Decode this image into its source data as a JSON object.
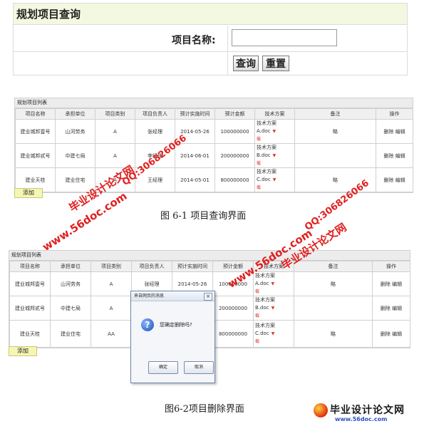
{
  "query_panel": {
    "title": "规划项目查询",
    "name_label": "项目名称:",
    "name_value": "",
    "query_button": "查询",
    "reset_button": "重置"
  },
  "table1": {
    "title": "规划项目列表",
    "headers": [
      "项目名称",
      "承担单位",
      "项目类别",
      "项目负责人",
      "预计实施时间",
      "预计金额",
      "技术方案",
      "备注",
      "操作"
    ],
    "rows": [
      [
        "建业城邦壹号",
        "山河劳务",
        "A",
        "张经理",
        "2014-05-26",
        "100000000",
        "技术方案A.doc",
        "略",
        "删除 编辑"
      ],
      [
        "建业城邦贰号",
        "中建七局",
        "A",
        "李经理",
        "2014-06-01",
        "200000000",
        "技术方案B.doc",
        "",
        "删除 编辑"
      ],
      [
        "建业天桂",
        "建业住宅",
        "A",
        "王经理",
        "2014-05-01",
        "800000000",
        "技术方案C.doc",
        "略",
        "删除 编辑"
      ]
    ],
    "download_label": "载",
    "add_button": "添加"
  },
  "caption1": "图 6-1 项目查询界面",
  "table2": {
    "title": "规划项目列表",
    "headers": [
      "项目名称",
      "承担单位",
      "项目类别",
      "项目负责人",
      "预计实施时间",
      "预计金额",
      "技术方案",
      "备注",
      "操作"
    ],
    "rows": [
      [
        "建业城邦壹号",
        "山河劳务",
        "A",
        "张经理",
        "2014-05-26",
        "100000000",
        "技术方案A.doc",
        "略",
        "删除 编辑"
      ],
      [
        "建业城邦贰号",
        "中建七局",
        "A",
        "",
        "",
        "200000000",
        "技术方案B.doc",
        "",
        "删除 编辑"
      ],
      [
        "建业天桂",
        "建业住宅",
        "AA",
        "",
        "",
        "800000000",
        "技术方案C.doc",
        "略",
        "删除 编辑"
      ]
    ],
    "download_label": "载",
    "add_button": "添加"
  },
  "dialog": {
    "title": "来自网页的消息",
    "close": "×",
    "message": "您确定删除吗?",
    "ok_button": "确定",
    "cancel_button": "取消"
  },
  "caption2": "图6-2项目删除界面",
  "watermarks": {
    "site": "www.56doc.com",
    "brand": "毕业设计论文网",
    "qq": "QQ:306826066",
    "logo_text": "毕业设计论文网",
    "logo_url": "www.56doc.com"
  },
  "colors": {
    "panel_title_bg": "#f3f8e0",
    "add_button_bg": "#f5f6b4",
    "watermark_red": "#e02020",
    "watermark_blue": "#4060e0"
  }
}
